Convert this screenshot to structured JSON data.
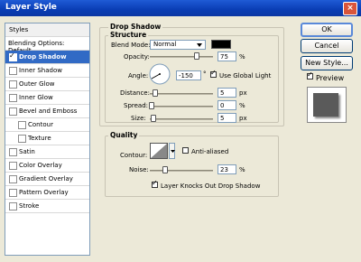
{
  "window": {
    "title": "Layer Style",
    "close_glyph": "×"
  },
  "styles_panel": {
    "header": "Styles",
    "items": [
      {
        "label": "Blending Options: Default"
      },
      {
        "label": "Drop Shadow",
        "checked": true,
        "selected": true
      },
      {
        "label": "Inner Shadow",
        "checked": false
      },
      {
        "label": "Outer Glow",
        "checked": false
      },
      {
        "label": "Inner Glow",
        "checked": false
      },
      {
        "label": "Bevel and Emboss",
        "checked": false
      },
      {
        "label": "Contour",
        "checked": false
      },
      {
        "label": "Texture",
        "checked": false
      },
      {
        "label": "Satin",
        "checked": false
      },
      {
        "label": "Color Overlay",
        "checked": false
      },
      {
        "label": "Gradient Overlay",
        "checked": false
      },
      {
        "label": "Pattern Overlay",
        "checked": false
      },
      {
        "label": "Stroke",
        "checked": false
      }
    ]
  },
  "drop_shadow": {
    "group_title": "Drop Shadow",
    "structure_title": "Structure",
    "blend_mode_label": "Blend Mode:",
    "blend_mode_value": "Normal",
    "color": "#000000",
    "opacity_label": "Opacity:",
    "opacity_value": "75",
    "opacity_unit": "%",
    "angle_label": "Angle:",
    "angle_value": "-150",
    "angle_unit": "°",
    "use_global_light_label": "Use Global Light",
    "use_global_light": true,
    "distance_label": "Distance:",
    "distance_value": "5",
    "distance_unit": "px",
    "spread_label": "Spread:",
    "spread_value": "0",
    "spread_unit": "%",
    "size_label": "Size:",
    "size_value": "5",
    "size_unit": "px"
  },
  "quality": {
    "title": "Quality",
    "contour_label": "Contour:",
    "anti_aliased_label": "Anti-aliased",
    "anti_aliased": false,
    "noise_label": "Noise:",
    "noise_value": "23",
    "noise_unit": "%",
    "knockout_label": "Layer Knocks Out Drop Shadow",
    "knockout": true
  },
  "buttons": {
    "ok": "OK",
    "cancel": "Cancel",
    "new_style": "New Style...",
    "preview_label": "Preview",
    "preview_checked": true
  }
}
